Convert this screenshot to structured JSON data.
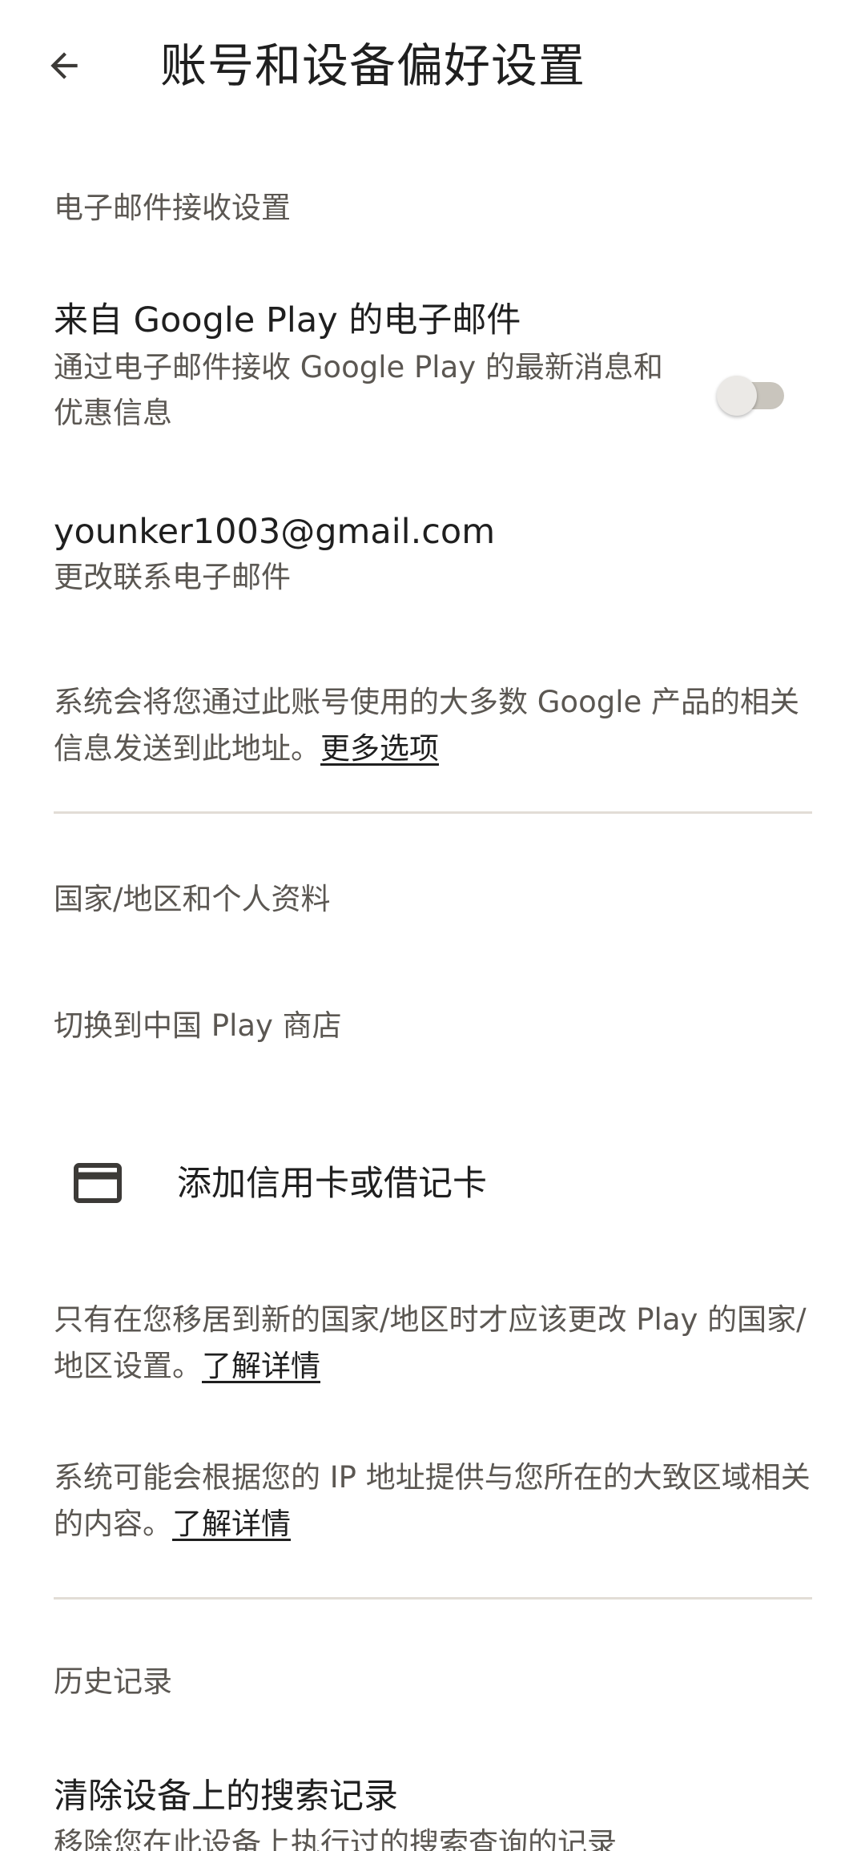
{
  "header": {
    "title": "账号和设备偏好设置",
    "back_icon": "arrow-back-icon"
  },
  "email_settings": {
    "heading": "电子邮件接收设置",
    "google_play_emails": {
      "title": "来自 Google Play 的电子邮件",
      "description": "通过电子邮件接收 Google Play 的最新消息和优惠信息",
      "toggle_on": false
    },
    "contact_email": {
      "address": "younker1003@gmail.com",
      "action": "更改联系电子邮件"
    },
    "notice": {
      "text": "系统会将您通过此账号使用的大多数 Google 产品的相关信息发送到此地址。",
      "link": "更多选项"
    }
  },
  "country_profile": {
    "heading": "国家/地区和个人资料",
    "switch_store": "切换到中国 Play 商店",
    "add_card": {
      "label": "添加信用卡或借记卡",
      "icon": "credit-card-icon"
    },
    "notice1": {
      "text": "只有在您移居到新的国家/地区时才应该更改 Play 的国家/地区设置。",
      "link": "了解详情"
    },
    "notice2": {
      "text": "系统可能会根据您的 IP 地址提供与您所在的大致区域相关的内容。",
      "link": "了解详情"
    }
  },
  "history": {
    "heading": "历史记录",
    "clear_search": {
      "title": "清除设备上的搜索记录",
      "description": "移除您在此设备上执行过的搜索查询的记录"
    }
  },
  "colors": {
    "background": "#ffffff",
    "primary_text": "#1f1f1f",
    "secondary_text": "#5b5752",
    "divider": "#e2ddd6",
    "toggle_track": "#c9c5bd",
    "toggle_thumb": "#ebe9e6"
  }
}
